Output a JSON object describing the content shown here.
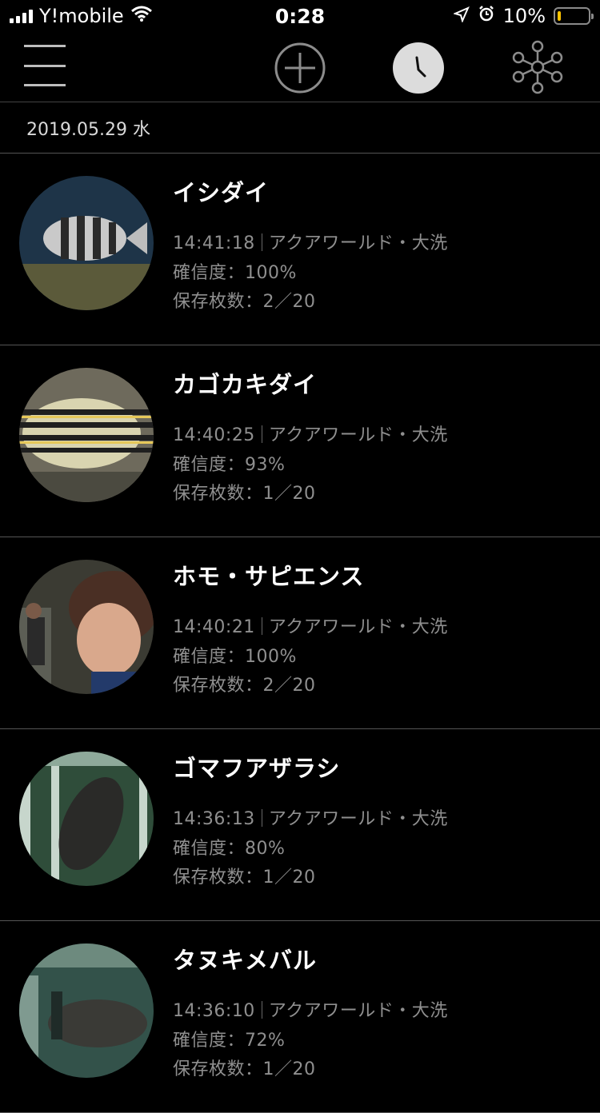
{
  "status_bar": {
    "carrier": "Y!mobile",
    "time": "0:28",
    "battery": "10%",
    "battery_color": "#ffc400"
  },
  "nav": {
    "icons": [
      "menu-icon",
      "add-circle-icon",
      "clock-icon",
      "network-tree-icon"
    ],
    "active": "clock-icon"
  },
  "date_header": "2019.05.29 水",
  "items": [
    {
      "name": "イシダイ",
      "time": "14:41:18",
      "place": "アクアワールド・大洗",
      "confidence": "確信度：100%",
      "count": "保存枚数：2／20"
    },
    {
      "name": "カゴカキダイ",
      "time": "14:40:25",
      "place": "アクアワールド・大洗",
      "confidence": "確信度：93%",
      "count": "保存枚数：1／20"
    },
    {
      "name": "ホモ・サピエンス",
      "time": "14:40:21",
      "place": "アクアワールド・大洗",
      "confidence": "確信度：100%",
      "count": "保存枚数：2／20"
    },
    {
      "name": "ゴマフアザラシ",
      "time": "14:36:13",
      "place": "アクアワールド・大洗",
      "confidence": "確信度：80%",
      "count": "保存枚数：1／20"
    },
    {
      "name": "タヌキメバル",
      "time": "14:36:10",
      "place": "アクアワールド・大洗",
      "confidence": "確信度：72%",
      "count": "保存枚数：1／20"
    }
  ]
}
